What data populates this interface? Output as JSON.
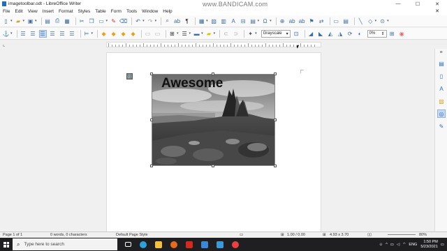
{
  "window": {
    "title": "imagetoolbar.odt - LibreOffice Writer",
    "watermark": "www.BANDICAM.com",
    "minimize": "—",
    "maximize": "☐",
    "close": "✕"
  },
  "menu": {
    "items": [
      "File",
      "Edit",
      "View",
      "Insert",
      "Format",
      "Styles",
      "Table",
      "Form",
      "Tools",
      "Window",
      "Help"
    ],
    "close_doc": "✕"
  },
  "toolbar": {
    "image_mode": "Grayscale",
    "transparency": "0%"
  },
  "document": {
    "image_title": "Awesome",
    "anchor_glyph": "⚓"
  },
  "status": {
    "page": "Page 1 of 1",
    "words": "0 words, 0 characters",
    "page_style": "Default Page Style",
    "position": "1.00 / 0.00",
    "size": "4.93 x 3.70",
    "zoom": "80%"
  },
  "taskbar": {
    "search_placeholder": "Type here to search",
    "language": "ENG",
    "time": "1:50 PM",
    "date": "5/23/2021"
  },
  "colors": {
    "accent": "#3a6ea5",
    "taskbar": "#1f1f22"
  }
}
